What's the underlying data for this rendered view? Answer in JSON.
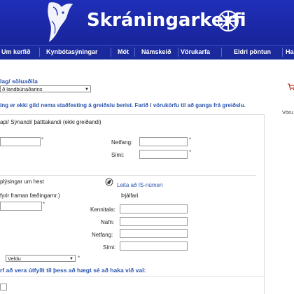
{
  "header": {
    "site_title": "Skráningarkerfi",
    "brand_color": "#1f2fb8"
  },
  "nav": {
    "items": [
      {
        "label": "Um kerfið"
      },
      {
        "label": "Kynbótasýningar"
      },
      {
        "label": "Mót"
      },
      {
        "label": "Námskeið"
      },
      {
        "label": "Vörukarfa"
      },
      {
        "label": "Eldri pöntun"
      },
      {
        "label": "Ha"
      }
    ]
  },
  "form": {
    "section_label": "lag/ söluaðila",
    "org_select_value": "ð landbúnaðarins",
    "warning_text": "ing er ekki gild nema staðfesting á greiðslu berist. Farið í vörukörfu til að ganga frá greiðslu.",
    "cart_side_label": "Vöru",
    "buyer_heading": "api/ Sýnandi/ þátttakandi (ekki greiðandi)",
    "netfang_label": "Netfang:",
    "simi_label": "Sími:",
    "horse_heading": "plýsingar um hest",
    "is_lookup_link": "Leita að IS-númeri",
    "birth_note": "fyrir framan fæðingarnr.)",
    "trainer_heading": "Þjálfari",
    "kennitala_label": "Kennitala:",
    "nafn_label": "Nafn:",
    "netfang2_label": "Netfang:",
    "simi2_label": "Sími:",
    "choose_select_value": "Veldu",
    "required_note": "rf að vera útfyllt til þess að hægt sé að haka við val:",
    "required_mark": "*"
  }
}
